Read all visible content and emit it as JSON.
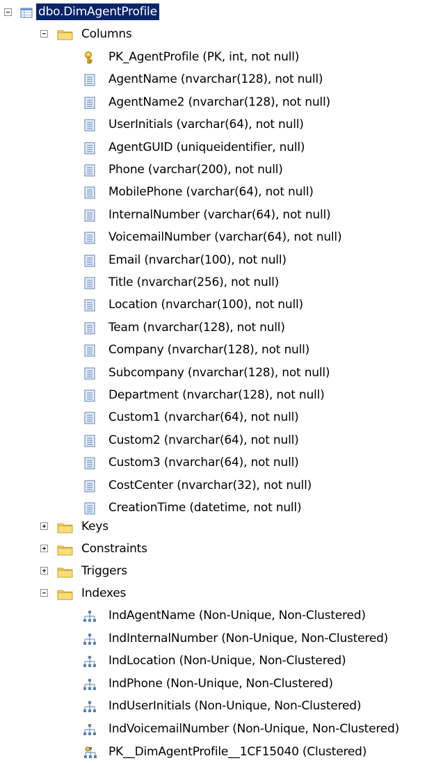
{
  "tree": {
    "table": {
      "label": "dbo.DimAgentProfile",
      "icon": "table-icon"
    },
    "columns_folder": {
      "label": "Columns",
      "icon": "folder-icon"
    },
    "columns": [
      {
        "label": "PK_AgentProfile (PK, int, not null)",
        "icon": "key-icon"
      },
      {
        "label": "AgentName (nvarchar(128), not null)",
        "icon": "column-icon"
      },
      {
        "label": "AgentName2 (nvarchar(128), not null)",
        "icon": "column-icon"
      },
      {
        "label": "UserInitials (varchar(64), not null)",
        "icon": "column-icon"
      },
      {
        "label": "AgentGUID (uniqueidentifier, null)",
        "icon": "column-icon"
      },
      {
        "label": "Phone (varchar(200), not null)",
        "icon": "column-icon"
      },
      {
        "label": "MobilePhone (varchar(64), not null)",
        "icon": "column-icon"
      },
      {
        "label": "InternalNumber (varchar(64), not null)",
        "icon": "column-icon"
      },
      {
        "label": "VoicemailNumber (varchar(64), not null)",
        "icon": "column-icon"
      },
      {
        "label": "Email (nvarchar(100), not null)",
        "icon": "column-icon"
      },
      {
        "label": "Title (nvarchar(256), not null)",
        "icon": "column-icon"
      },
      {
        "label": "Location (nvarchar(100), not null)",
        "icon": "column-icon"
      },
      {
        "label": "Team (nvarchar(128), not null)",
        "icon": "column-icon"
      },
      {
        "label": "Company (nvarchar(128), not null)",
        "icon": "column-icon"
      },
      {
        "label": "Subcompany (nvarchar(128), not null)",
        "icon": "column-icon"
      },
      {
        "label": "Department (nvarchar(128), not null)",
        "icon": "column-icon"
      },
      {
        "label": "Custom1 (nvarchar(64), not null)",
        "icon": "column-icon"
      },
      {
        "label": "Custom2 (nvarchar(64), not null)",
        "icon": "column-icon"
      },
      {
        "label": "Custom3 (nvarchar(64), not null)",
        "icon": "column-icon"
      },
      {
        "label": "CostCenter (nvarchar(32), not null)",
        "icon": "column-icon"
      },
      {
        "label": "CreationTime (datetime, not null)",
        "icon": "column-icon"
      }
    ],
    "folders": [
      {
        "label": "Keys",
        "expanded": false,
        "icon": "folder-icon"
      },
      {
        "label": "Constraints",
        "expanded": false,
        "icon": "folder-icon"
      },
      {
        "label": "Triggers",
        "expanded": false,
        "icon": "folder-icon"
      },
      {
        "label": "Indexes",
        "expanded": true,
        "icon": "folder-icon"
      }
    ],
    "indexes": [
      {
        "label": "IndAgentName (Non-Unique, Non-Clustered)",
        "icon": "index-icon"
      },
      {
        "label": "IndInternalNumber (Non-Unique, Non-Clustered)",
        "icon": "index-icon"
      },
      {
        "label": "IndLocation (Non-Unique, Non-Clustered)",
        "icon": "index-icon"
      },
      {
        "label": "IndPhone (Non-Unique, Non-Clustered)",
        "icon": "index-icon"
      },
      {
        "label": "IndUserInitials (Non-Unique, Non-Clustered)",
        "icon": "index-icon"
      },
      {
        "label": "IndVoicemailNumber (Non-Unique, Non-Clustered)",
        "icon": "index-icon"
      },
      {
        "label": "PK__DimAgentProfile__1CF15040 (Clustered)",
        "icon": "clustered-index-icon"
      }
    ]
  }
}
